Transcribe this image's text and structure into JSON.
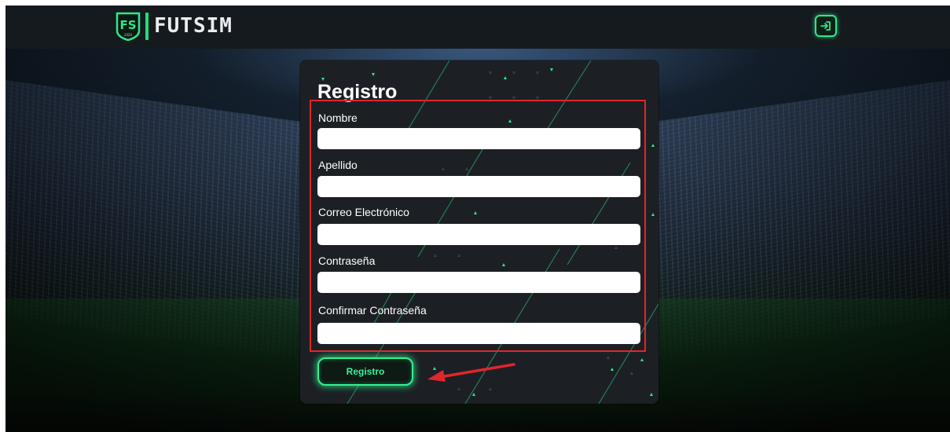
{
  "header": {
    "brand_name": "FUTSIM",
    "logo_monogram": "FS",
    "logo_caption": "2020",
    "login_button_icon": "login-icon"
  },
  "form": {
    "title": "Registro",
    "fields": [
      {
        "label": "Nombre",
        "value": "",
        "placeholder": ""
      },
      {
        "label": "Apellido",
        "value": "",
        "placeholder": ""
      },
      {
        "label": "Correo Electrónico",
        "value": "",
        "placeholder": ""
      },
      {
        "label": "Contraseña",
        "value": "",
        "placeholder": ""
      },
      {
        "label": "Confirmar Contraseña",
        "value": "",
        "placeholder": ""
      }
    ],
    "submit_label": "Registro"
  },
  "annotations": {
    "highlight_box_color": "#e0262b",
    "arrow_color": "#e0262b"
  },
  "colors": {
    "accent": "#2ee88a",
    "navbar": "#151a1f",
    "card": "#1c2024"
  }
}
